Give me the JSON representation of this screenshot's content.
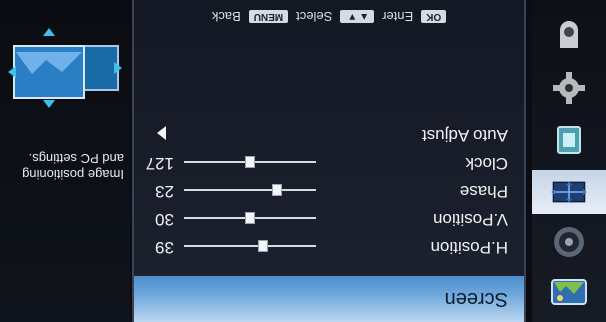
{
  "menu": {
    "icons": [
      {
        "name": "picture-settings-icon",
        "selected": false
      },
      {
        "name": "audio-settings-icon",
        "selected": false
      },
      {
        "name": "screen-settings-icon",
        "selected": true
      },
      {
        "name": "timer-settings-icon",
        "selected": false
      },
      {
        "name": "setup-gear-icon",
        "selected": false
      },
      {
        "name": "camera-icon",
        "selected": false
      }
    ]
  },
  "panel": {
    "title": "Screen",
    "items": [
      {
        "label": "H.Position",
        "value": "39",
        "fraction": 0.39
      },
      {
        "label": "V.Position",
        "value": "30",
        "fraction": 0.5
      },
      {
        "label": "Phase",
        "value": "23",
        "fraction": 0.28
      },
      {
        "label": "Clock",
        "value": "127",
        "fraction": 0.5
      },
      {
        "label": "Auto Adjust"
      }
    ]
  },
  "nav": {
    "ok_key": "OK",
    "ok_label": "Enter",
    "arrow_key": "▲▼",
    "select_label": "Select",
    "menu_key": "MENU",
    "back_label": "Back"
  },
  "description": {
    "text": "Image positioning and PC settings."
  },
  "colors": {
    "title_bar": "#6ea7dc",
    "selected_icon_bg": "#dbe4f3"
  }
}
